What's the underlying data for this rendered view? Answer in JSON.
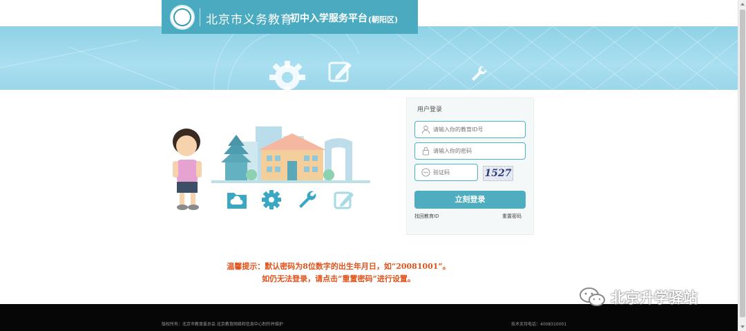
{
  "header": {
    "title_main": "北京市义务教育",
    "title_sub": "初中入学服务平台",
    "title_district": "(朝阳区)",
    "logo_icon": "emblem-icon"
  },
  "banner": {
    "icons": [
      "gear-icon",
      "edit-icon",
      "wrench-icon"
    ]
  },
  "illustration": {
    "icons": [
      "folder-cloud-icon",
      "gear-icon",
      "wrench-icon",
      "edit-icon"
    ]
  },
  "login": {
    "title": "用户登录",
    "edu_id_placeholder": "请输入你的教育ID号",
    "password_placeholder": "请输入你的密码",
    "captcha_placeholder": "验证码",
    "captcha_text": "1527",
    "submit_label": "立刻登录",
    "find_id_link": "找回教育ID",
    "reset_password_link": "重置密码"
  },
  "notice": {
    "line1": "温馨提示：默认密码为8位数字的出生年月日，如“20081001”。",
    "line2": "如仍无法登录，请点击“重置密码”进行设置。"
  },
  "footer": {
    "copyright": "版权所有：北京市教育委员会 北京教育网络和信息中心制作并维护",
    "support": "技术支持电话：4008310001"
  },
  "watermark": {
    "text": "北京升学驿站"
  },
  "colors": {
    "accent": "#4eaebf",
    "header_tab": "#4aaabf",
    "banner": "#a9dff0",
    "notice": "#e0521a",
    "footer": "#060606"
  }
}
